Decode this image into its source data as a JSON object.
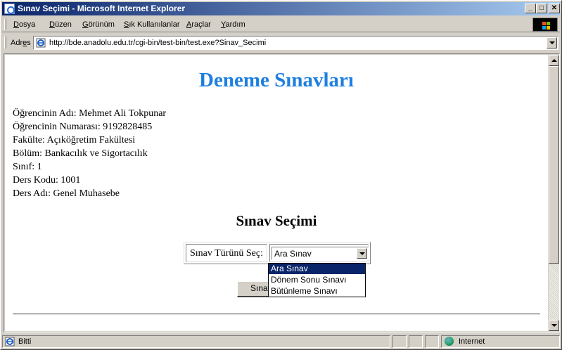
{
  "window": {
    "title": "Sınav Seçimi - Microsoft Internet Explorer",
    "minimize": "_",
    "maximize": "□",
    "close": "✕"
  },
  "menu": {
    "items": [
      {
        "first": "D",
        "rest": "osya"
      },
      {
        "first": "D",
        "rest": "üzen"
      },
      {
        "first": "G",
        "rest": "örünüm"
      },
      {
        "first": "S",
        "rest": "ık Kullanılanlar"
      },
      {
        "first": "A",
        "rest": "raçlar"
      },
      {
        "first": "Y",
        "rest": "ardım"
      }
    ]
  },
  "address": {
    "label_pre": "Adr",
    "label_u": "e",
    "label_post": "s",
    "url": "http://bde.anadolu.edu.tr/cgi-bin/test-bin/test.exe?Sinav_Secimi"
  },
  "page": {
    "heading": "Deneme Sınavları",
    "info": [
      "Öğrencinin Adı: Mehmet Ali Tokpunar",
      "Öğrencinin Numarası: 9192828485",
      "Fakülte: Açıköğretim Fakültesi",
      "Bölüm: Bankacılık ve Sigortacılık",
      "Sınıf: 1",
      "Ders Kodu: 1001",
      "Ders Adı: Genel Muhasebe"
    ],
    "sub_heading": "Sınav Seçimi",
    "select_label": "Sınav Türünü Seç:",
    "select_value": "Ara Sınav",
    "options": [
      "Ara Sınav",
      "Dönem Sonu Sınavı",
      "Bütünleme Sınavı"
    ],
    "submit_label": "Sınav"
  },
  "status": {
    "text": "Bitti",
    "zone": "Internet"
  },
  "colors": {
    "heading": "#1e7fe0",
    "titlebar_start": "#0a246a",
    "titlebar_end": "#a6caf0",
    "selection": "#0a246a"
  },
  "icons": {
    "app": "ie-icon",
    "page": "ie-page-icon",
    "zone": "globe-icon"
  }
}
